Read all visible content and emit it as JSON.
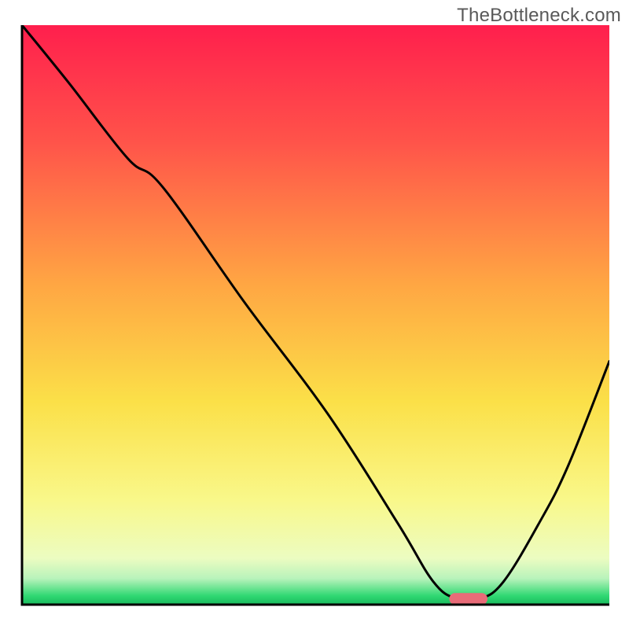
{
  "watermark": "TheBottleneck.com",
  "chart_data": {
    "type": "line",
    "title": "",
    "xlabel": "",
    "ylabel": "",
    "xlim": [
      0,
      100
    ],
    "ylim": [
      0,
      100
    ],
    "grid": false,
    "legend": false,
    "background_gradient": {
      "stops": [
        {
          "offset": 0.0,
          "color": "#ff1f4d"
        },
        {
          "offset": 0.2,
          "color": "#ff534a"
        },
        {
          "offset": 0.45,
          "color": "#ffa743"
        },
        {
          "offset": 0.65,
          "color": "#fbe048"
        },
        {
          "offset": 0.82,
          "color": "#f9f88a"
        },
        {
          "offset": 0.92,
          "color": "#ecfcc1"
        },
        {
          "offset": 0.955,
          "color": "#b8f3bb"
        },
        {
          "offset": 0.985,
          "color": "#2fd872"
        },
        {
          "offset": 1.0,
          "color": "#1aba5d"
        }
      ]
    },
    "series": [
      {
        "name": "bottleneck-curve",
        "type": "line",
        "color": "#000000",
        "x": [
          0,
          8,
          18,
          24,
          38,
          52,
          64,
          70,
          74,
          78,
          82,
          88,
          93,
          100
        ],
        "y": [
          100,
          90,
          77,
          72,
          52,
          33,
          14,
          4,
          1,
          1,
          4,
          14,
          24,
          42
        ]
      }
    ],
    "markers": [
      {
        "name": "optimal-zone",
        "type": "pill",
        "color": "#e86b78",
        "x_center": 76,
        "y_center": 1,
        "width": 6.5,
        "thickness": 2.0
      }
    ],
    "axes": {
      "left": {
        "visible": true,
        "color": "#000000",
        "width": 3
      },
      "bottom": {
        "visible": true,
        "color": "#000000",
        "width": 3
      },
      "top": {
        "visible": false
      },
      "right": {
        "visible": false
      }
    }
  }
}
